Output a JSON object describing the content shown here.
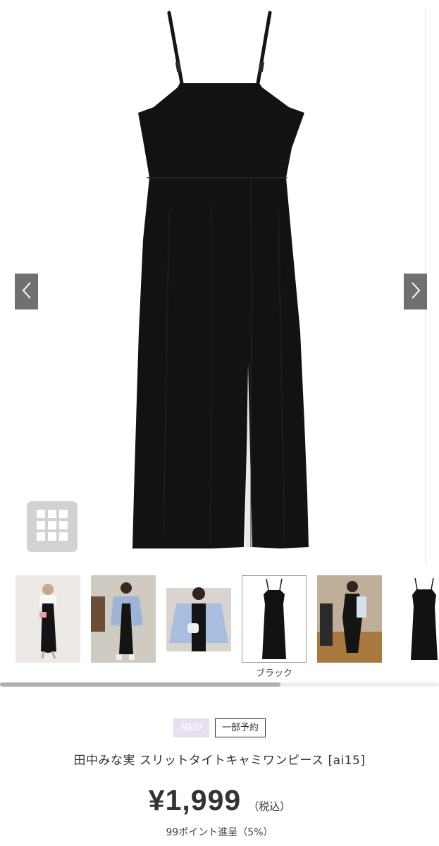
{
  "gallery": {
    "prev_icon": "chevron-left-icon",
    "next_icon": "chevron-right-icon",
    "grid_icon": "grid-icon",
    "thumbnails": [
      {
        "name": "model-white-top-photo"
      },
      {
        "name": "model-denim-shirt-photo"
      },
      {
        "name": "model-blue-shirt-closeup-photo"
      },
      {
        "name": "black-dress-flatlay",
        "caption": "ブラック"
      },
      {
        "name": "model-cafe-photo"
      },
      {
        "name": "black-dress-flatlay-partial"
      }
    ],
    "selected_index": 3,
    "scroll_position": 0.64
  },
  "product": {
    "badge_new": "NEW",
    "badge_preorder": "一部予約",
    "name": "田中みな実 スリットタイトキャミワンピース [ai15]",
    "price": "¥1,999",
    "tax_label": "（税込）",
    "points": "99ポイント進呈（5%）"
  },
  "colors": {
    "dress": "#121212",
    "nav_button": "#707070",
    "badge_new_bg": "#e8dff0"
  }
}
